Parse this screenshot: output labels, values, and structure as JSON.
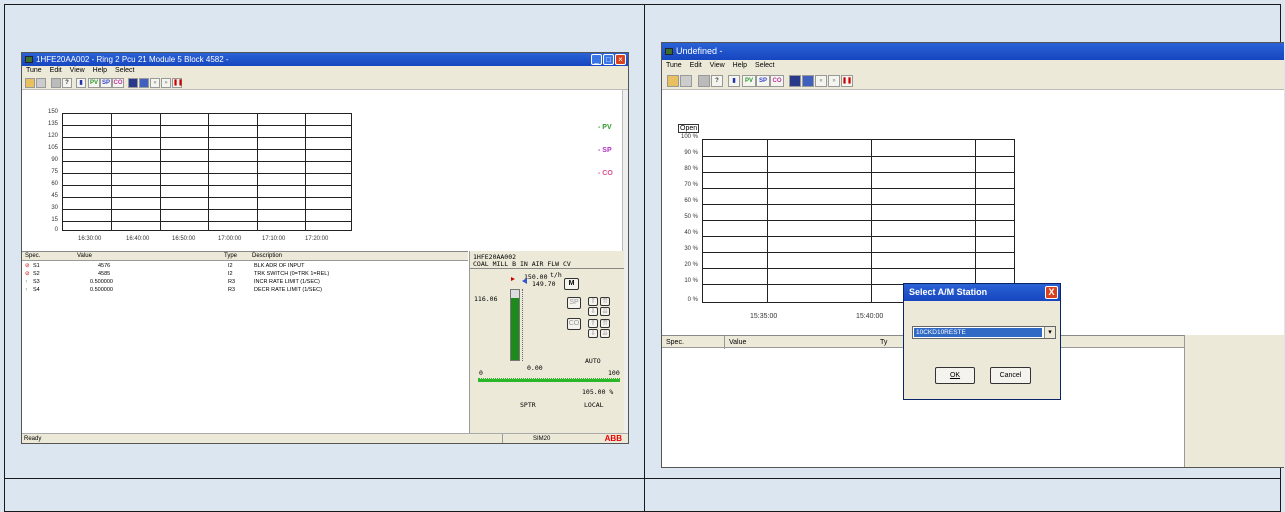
{
  "left_window": {
    "title": "1HFE20AA002 - Ring 2 Pcu 21 Module 5 Block 4582 -",
    "menu": [
      "Tune",
      "Edit",
      "View",
      "Help",
      "Select"
    ],
    "toolbar": [
      "open",
      "save",
      "print",
      "help",
      "pv-bar",
      "PV",
      "SP",
      "CO",
      "station",
      "trend",
      "rewind",
      "forward",
      "pause"
    ],
    "chart": {
      "y_ticks": [
        "150",
        "135",
        "120",
        "105",
        "90",
        "75",
        "60",
        "45",
        "30",
        "15",
        "0"
      ],
      "x_ticks": [
        "16:30:00",
        "16:40:00",
        "16:50:00",
        "17:00:00",
        "17:10:00",
        "17:20:00"
      ],
      "legend": [
        {
          "label": "- PV",
          "color": "#2a9a2a"
        },
        {
          "label": "- SP",
          "color": "#b030c0"
        },
        {
          "label": "- CO",
          "color": "#e0508a"
        }
      ]
    },
    "table": {
      "headers": [
        "Spec.",
        "Value",
        "Type",
        "Description"
      ],
      "rows": [
        {
          "spec": "S1",
          "value": "4576",
          "type": "I2",
          "desc": "BLK ADR OF INPUT",
          "icon": "no"
        },
        {
          "spec": "S2",
          "value": "4585",
          "type": "I2",
          "desc": "TRK SWITCH (0=TRK 1=REL)",
          "icon": "no"
        },
        {
          "spec": "S3",
          "value": "0.500000",
          "type": "R3",
          "desc": "INCR RATE LIMIT (1/SEC)",
          "icon": "tune"
        },
        {
          "spec": "S4",
          "value": "0.500000",
          "type": "R3",
          "desc": "DECR RATE LIMIT (1/SEC)",
          "icon": "tune"
        }
      ]
    },
    "faceplate": {
      "tag": "1HFE20AA002",
      "desc": "COAL MILL B IN AIR FLW CV",
      "sp_value": "150.00",
      "unit": "t/h",
      "pv_value": "149.70",
      "mode_btn": "M",
      "left_value": "116.06",
      "sp_btn": "SP",
      "co_btn": "CO",
      "output_value": "0.00",
      "mode": "AUTO",
      "scale_min": "0",
      "scale_max": "100",
      "percent": "105.00 %",
      "sptr": "SPTR",
      "local": "LOCAL"
    },
    "status": {
      "left": "Ready",
      "mid": "SIM20",
      "logo": "ABB"
    }
  },
  "right_window": {
    "title": "Undefined -",
    "menu": [
      "Tune",
      "Edit",
      "View",
      "Help",
      "Select"
    ],
    "open_label": "Open",
    "chart": {
      "y_ticks": [
        "100 %",
        "90 %",
        "80 %",
        "70 %",
        "60 %",
        "50 %",
        "40 %",
        "30 %",
        "20 %",
        "10 %",
        "0 %"
      ],
      "x_ticks": [
        "15:35:00",
        "15:40:00"
      ]
    },
    "table_headers": [
      "Spec.",
      "Value",
      "Ty"
    ],
    "dialog": {
      "title": "Select A/M Station",
      "selected": "10CKD10RESTE",
      "ok": "OK",
      "cancel": "Cancel"
    }
  }
}
